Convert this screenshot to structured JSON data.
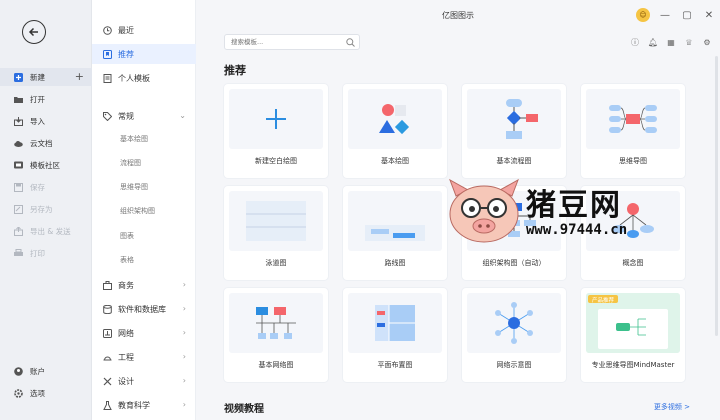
{
  "app": {
    "title": "亿图图示"
  },
  "rail": {
    "items": [
      {
        "label": "新建",
        "icon": "new-icon"
      },
      {
        "label": "打开",
        "icon": "folder-icon"
      },
      {
        "label": "导入",
        "icon": "import-icon"
      },
      {
        "label": "云文档",
        "icon": "cloud-icon"
      },
      {
        "label": "模板社区",
        "icon": "community-icon"
      },
      {
        "label": "保存",
        "icon": "save-icon"
      },
      {
        "label": "另存为",
        "icon": "save-as-icon"
      },
      {
        "label": "导出 & 发送",
        "icon": "export-icon"
      },
      {
        "label": "打印",
        "icon": "print-icon"
      }
    ],
    "bottom": [
      {
        "label": "账户",
        "icon": "account-icon"
      },
      {
        "label": "选项",
        "icon": "settings-icon"
      }
    ],
    "plus": "+"
  },
  "categories": {
    "top": [
      {
        "label": "最近"
      },
      {
        "label": "推荐"
      },
      {
        "label": "个人模板"
      }
    ],
    "group": {
      "label": "常规"
    },
    "sub": [
      "基本绘图",
      "流程图",
      "思维导图",
      "组织架构图",
      "图表",
      "表格"
    ],
    "more": [
      {
        "label": "商务"
      },
      {
        "label": "软件和数据库"
      },
      {
        "label": "网络"
      },
      {
        "label": "工程"
      },
      {
        "label": "设计"
      },
      {
        "label": "教育科学"
      }
    ]
  },
  "search": {
    "placeholder": "搜索模板..."
  },
  "section": {
    "title": "推荐"
  },
  "cards": [
    {
      "label": "新建空白绘图",
      "icon": "plus-icon"
    },
    {
      "label": "基本绘图",
      "icon": "shapes-icon"
    },
    {
      "label": "基本流程图",
      "icon": "flowchart-icon"
    },
    {
      "label": "思维导图",
      "icon": "mindmap-icon"
    },
    {
      "label": "泳道图",
      "icon": "swimlane-icon"
    },
    {
      "label": "路线图",
      "icon": "roadmap-icon"
    },
    {
      "label": "组织架构图（自动）",
      "icon": "orgchart-icon"
    },
    {
      "label": "概念图",
      "icon": "concept-icon"
    },
    {
      "label": "基本网络图",
      "icon": "network-icon"
    },
    {
      "label": "平面布置图",
      "icon": "floorplan-icon"
    },
    {
      "label": "网络示意图",
      "icon": "hub-icon"
    },
    {
      "label": "专业思维导图MindMaster",
      "icon": "mindmaster-icon",
      "badge": "产品推荐"
    }
  ],
  "videos": {
    "title": "视频教程",
    "more": "更多视频 >"
  },
  "watermark": {
    "text": "猪豆网",
    "url": "www.97444.cn"
  },
  "colors": {
    "accent": "#2b6de0",
    "red": "#f4666b",
    "blue": "#4a9cf0",
    "lightblue": "#a9cdf6"
  }
}
